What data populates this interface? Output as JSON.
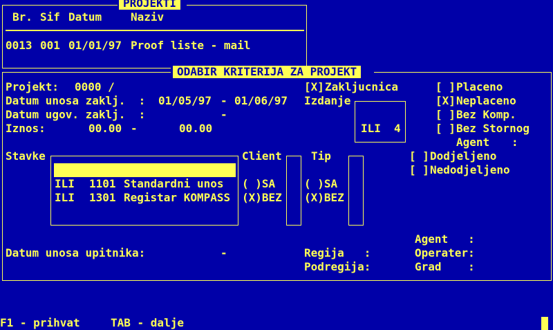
{
  "projects_panel": {
    "title": "PROJEKTI",
    "columns": {
      "br": "Br.",
      "sif": "Sif",
      "datum": "Datum",
      "naziv": "Naziv"
    },
    "rows": [
      {
        "br": "0013",
        "sif": "001",
        "datum": "01/01/97",
        "naziv": "Proof liste - mail"
      }
    ]
  },
  "criteria_panel": {
    "title": "ODABIR KRITERIJA ZA PROJEKT",
    "projekt_label": "Projekt:",
    "projekt_value": "0000 /",
    "datum_unosa_label": "Datum unosa zaklj.  :",
    "datum_unosa_from": "01/05/97",
    "datum_unosa_dash": "-",
    "datum_unosa_to": "01/06/97",
    "datum_ugov_label": "Datum ugov. zaklj.  :",
    "datum_ugov_dash": "-",
    "iznos_label": "Iznos:",
    "iznos_from": "00.00",
    "iznos_dash": "-",
    "iznos_to": "00.00",
    "zakljucnica": {
      "mark": "[X]",
      "label": "Zakljucnica"
    },
    "izdanje_label": "Izdanje",
    "izdanje_box": {
      "mode": "ILI",
      "value": "4"
    },
    "checks": [
      {
        "mark": "[ ]",
        "label": "Placeno"
      },
      {
        "mark": "[X]",
        "label": "Neplaceno"
      },
      {
        "mark": "[ ]",
        "label": "Bez Komp."
      },
      {
        "mark": "[ ]",
        "label": "Bez Stornog"
      }
    ],
    "agent_top": {
      "label": "Agent",
      "colon": ":"
    },
    "dodjeljeno": {
      "mark": "[ ]",
      "label": "Dodjeljeno"
    },
    "nedodjeljeno": {
      "mark": "[ ]",
      "label": "Nedodjeljeno"
    },
    "stavke_label": "Stavke",
    "stavke_items": [
      {
        "mode": "ILI",
        "code": "1101",
        "name": "Standardni unos"
      },
      {
        "mode": "ILI",
        "code": "1301",
        "name": "Registar KOMPASS"
      }
    ],
    "client": {
      "label": "Client",
      "opt1": "( )SA",
      "opt2": "(X)BEZ"
    },
    "tip": {
      "label": "Tip",
      "opt1": "( )SA",
      "opt2": "(X)BEZ"
    },
    "datum_upitnika_label": "Datum unosa upitnika:",
    "datum_upitnika_dash": "-",
    "regija_label": "Regija   :",
    "podregija_label": "Podregija:",
    "agent_label": "Agent   :",
    "operater_label": "Operater:",
    "grad_label": "Grad    :"
  },
  "footer": {
    "f1": "F1 - prihvat",
    "tab": "TAB - dalje"
  }
}
